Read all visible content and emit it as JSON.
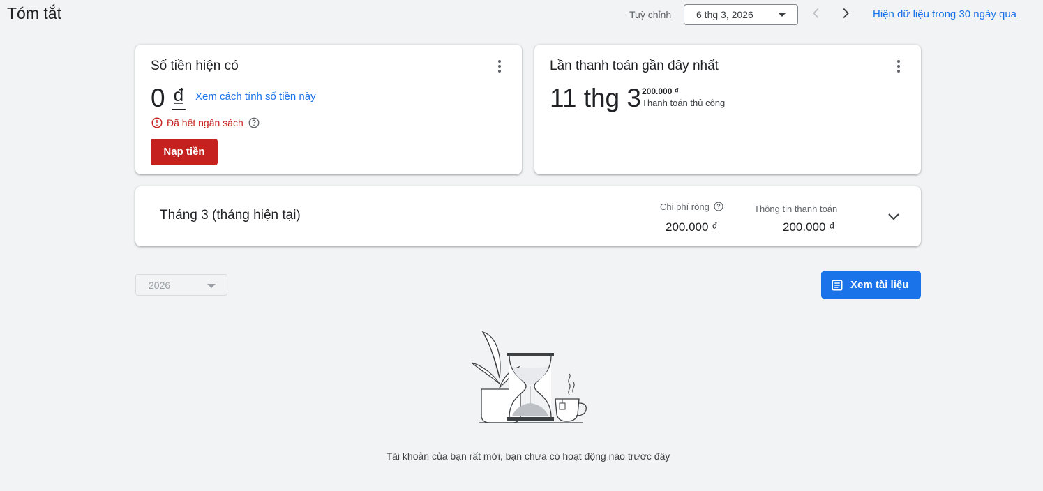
{
  "header": {
    "title": "Tóm tắt",
    "custom_label": "Tuỳ chỉnh",
    "date_value": "6 thg 3, 2026",
    "show_data_link": "Hiện dữ liệu trong 30 ngày qua"
  },
  "balance_card": {
    "title": "Số tiền hiện có",
    "amount": "0",
    "currency": "₫",
    "calc_link": "Xem cách tính số tiền này",
    "warning": "Đã hết ngân sách",
    "topup_label": "Nạp tiền"
  },
  "payment_card": {
    "title": "Lần thanh toán gần đây nhất",
    "date": "11 thg 3",
    "amount": "200.000 ₫",
    "method": "Thanh toán thủ công"
  },
  "month_card": {
    "title": "Tháng 3 (tháng hiện tại)",
    "net_cost_label": "Chi phí ròng",
    "net_cost_value": "200.000",
    "billing_label": "Thông tin thanh toán",
    "billing_value": "200.000",
    "currency": "₫"
  },
  "filters": {
    "year": "2026",
    "docs_button": "Xem tài liệu"
  },
  "empty_state": {
    "message": "Tài khoản của bạn rất mới, bạn chưa có hoạt động nào trước đây"
  },
  "colors": {
    "accent": "#1a73e8",
    "danger": "#c5221f",
    "background": "#f1f3f4"
  },
  "icons": [
    "chevron-left-icon",
    "chevron-right-icon",
    "more-vert-icon",
    "error-icon",
    "help-icon",
    "expand-more-icon",
    "document-icon",
    "hourglass-illustration"
  ]
}
